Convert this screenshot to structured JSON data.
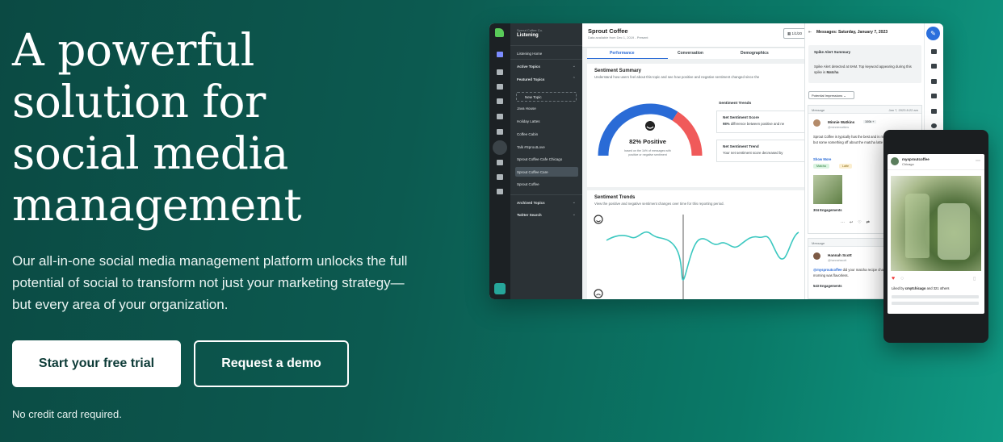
{
  "hero": {
    "title": "A powerful solution for social media management",
    "subtitle": "Our all-in-one social media management platform unlocks the full potential of social to transform not just your marketing strategy—but every area of your organization.",
    "cta_primary": "Start your free trial",
    "cta_secondary": "Request a demo",
    "note": "No credit card required."
  },
  "app": {
    "sidebar": {
      "org": "Sprout Coffee Co.",
      "title": "Listening",
      "items": [
        "Listening Home",
        "Active Topics",
        "Featured Topics",
        "New Topic",
        "Java House",
        "Holiday Lattes",
        "Coffee Cabin",
        "Talk #SproutLove",
        "Sprout Coffee Cafe Chicago",
        "Sprout Coffee Care",
        "Sprout Coffee",
        "Archived Topics",
        "Twitter Search"
      ]
    },
    "main": {
      "title": "Sprout Coffee",
      "availability": "Data available from Dec 1, 2019 - Present",
      "date_button": "1/1/20",
      "tabs": [
        "Performance",
        "Conversation",
        "Demographics"
      ],
      "summary": {
        "heading": "Sentiment Summary",
        "desc": "Understand how users feel about this topic and see how positive and negative sentiment changed since the",
        "gauge_value": "82% Positive",
        "gauge_note": "based on the 1k% of messages with positive or negative sentiment",
        "trends_heading": "Sentiment Trends",
        "score_title": "Net Sentiment Score",
        "score_desc_value": "98%",
        "score_desc": "difference between positive and ne",
        "trend_title": "Net Sentiment Trend",
        "trend_desc": "Your net sentiment score decreased by"
      },
      "trends": {
        "heading": "Sentiment Trends",
        "desc": "View the positive and negative sentiment changes over time for this reporting period."
      }
    },
    "messages": {
      "header": "Messages: Saturday, January 7, 2023",
      "spike_title": "Spike Alert Summary",
      "spike_body_1": "Spike Alert detected at 8AM. Top keyword appearing during this spike is",
      "spike_keyword": "Matcha",
      "filter": "Potential Impressions",
      "post1": {
        "label": "Message",
        "time": "Jan 7, 2023 8:22 am",
        "name": "Minnie Watkins",
        "badge": "100k +",
        "handle": "@minniewatkins",
        "text": "Sprout Coffee is typically has the best and is my go-to. Not sure why but some something off about the matcha latte",
        "more": "Show More",
        "tags": [
          "Matcha",
          "Latte"
        ],
        "engagements": "304 Engagements"
      },
      "post2": {
        "label": "Message",
        "name": "Hannah Scott",
        "handle": "@hannahscott",
        "mention": "@mysproutcoffee",
        "text": "did your matcha recipe change? My drink this morning was flavorless.",
        "engagements": "543 Engagements"
      }
    }
  },
  "phone": {
    "account": "mysproutcoffee",
    "location": "Chicago",
    "liked_by": "Liked by",
    "liked_user": "cmytchicago",
    "liked_rest": "and 321 others"
  },
  "colors": {
    "bg_start": "#0b4a43",
    "bg_end": "#109a84",
    "accent_blue": "#2a6bd6",
    "gauge_red": "#f05a5a",
    "chart_line": "#3cc8c0"
  }
}
